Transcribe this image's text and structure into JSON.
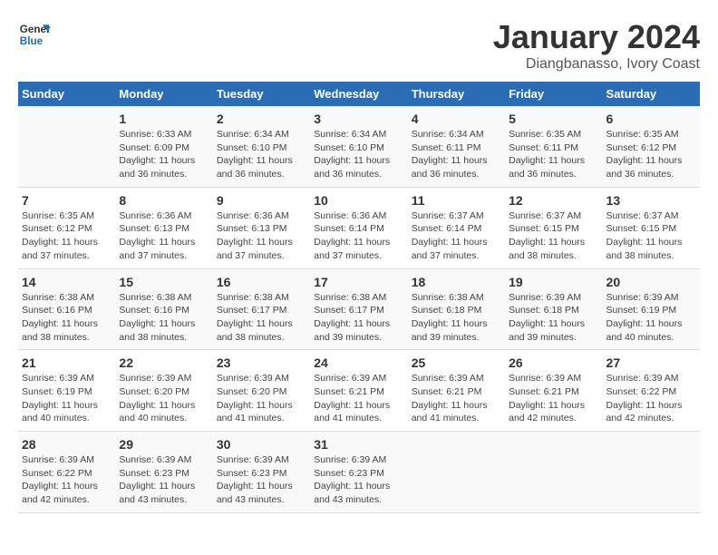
{
  "logo": {
    "line1": "General",
    "line2": "Blue"
  },
  "title": "January 2024",
  "subtitle": "Diangbanasso, Ivory Coast",
  "days_of_week": [
    "Sunday",
    "Monday",
    "Tuesday",
    "Wednesday",
    "Thursday",
    "Friday",
    "Saturday"
  ],
  "weeks": [
    [
      {
        "day": "",
        "info": ""
      },
      {
        "day": "1",
        "info": "Sunrise: 6:33 AM\nSunset: 6:09 PM\nDaylight: 11 hours\nand 36 minutes."
      },
      {
        "day": "2",
        "info": "Sunrise: 6:34 AM\nSunset: 6:10 PM\nDaylight: 11 hours\nand 36 minutes."
      },
      {
        "day": "3",
        "info": "Sunrise: 6:34 AM\nSunset: 6:10 PM\nDaylight: 11 hours\nand 36 minutes."
      },
      {
        "day": "4",
        "info": "Sunrise: 6:34 AM\nSunset: 6:11 PM\nDaylight: 11 hours\nand 36 minutes."
      },
      {
        "day": "5",
        "info": "Sunrise: 6:35 AM\nSunset: 6:11 PM\nDaylight: 11 hours\nand 36 minutes."
      },
      {
        "day": "6",
        "info": "Sunrise: 6:35 AM\nSunset: 6:12 PM\nDaylight: 11 hours\nand 36 minutes."
      }
    ],
    [
      {
        "day": "7",
        "info": "Sunrise: 6:35 AM\nSunset: 6:12 PM\nDaylight: 11 hours\nand 37 minutes."
      },
      {
        "day": "8",
        "info": "Sunrise: 6:36 AM\nSunset: 6:13 PM\nDaylight: 11 hours\nand 37 minutes."
      },
      {
        "day": "9",
        "info": "Sunrise: 6:36 AM\nSunset: 6:13 PM\nDaylight: 11 hours\nand 37 minutes."
      },
      {
        "day": "10",
        "info": "Sunrise: 6:36 AM\nSunset: 6:14 PM\nDaylight: 11 hours\nand 37 minutes."
      },
      {
        "day": "11",
        "info": "Sunrise: 6:37 AM\nSunset: 6:14 PM\nDaylight: 11 hours\nand 37 minutes."
      },
      {
        "day": "12",
        "info": "Sunrise: 6:37 AM\nSunset: 6:15 PM\nDaylight: 11 hours\nand 38 minutes."
      },
      {
        "day": "13",
        "info": "Sunrise: 6:37 AM\nSunset: 6:15 PM\nDaylight: 11 hours\nand 38 minutes."
      }
    ],
    [
      {
        "day": "14",
        "info": "Sunrise: 6:38 AM\nSunset: 6:16 PM\nDaylight: 11 hours\nand 38 minutes."
      },
      {
        "day": "15",
        "info": "Sunrise: 6:38 AM\nSunset: 6:16 PM\nDaylight: 11 hours\nand 38 minutes."
      },
      {
        "day": "16",
        "info": "Sunrise: 6:38 AM\nSunset: 6:17 PM\nDaylight: 11 hours\nand 38 minutes."
      },
      {
        "day": "17",
        "info": "Sunrise: 6:38 AM\nSunset: 6:17 PM\nDaylight: 11 hours\nand 39 minutes."
      },
      {
        "day": "18",
        "info": "Sunrise: 6:38 AM\nSunset: 6:18 PM\nDaylight: 11 hours\nand 39 minutes."
      },
      {
        "day": "19",
        "info": "Sunrise: 6:39 AM\nSunset: 6:18 PM\nDaylight: 11 hours\nand 39 minutes."
      },
      {
        "day": "20",
        "info": "Sunrise: 6:39 AM\nSunset: 6:19 PM\nDaylight: 11 hours\nand 40 minutes."
      }
    ],
    [
      {
        "day": "21",
        "info": "Sunrise: 6:39 AM\nSunset: 6:19 PM\nDaylight: 11 hours\nand 40 minutes."
      },
      {
        "day": "22",
        "info": "Sunrise: 6:39 AM\nSunset: 6:20 PM\nDaylight: 11 hours\nand 40 minutes."
      },
      {
        "day": "23",
        "info": "Sunrise: 6:39 AM\nSunset: 6:20 PM\nDaylight: 11 hours\nand 41 minutes."
      },
      {
        "day": "24",
        "info": "Sunrise: 6:39 AM\nSunset: 6:21 PM\nDaylight: 11 hours\nand 41 minutes."
      },
      {
        "day": "25",
        "info": "Sunrise: 6:39 AM\nSunset: 6:21 PM\nDaylight: 11 hours\nand 41 minutes."
      },
      {
        "day": "26",
        "info": "Sunrise: 6:39 AM\nSunset: 6:21 PM\nDaylight: 11 hours\nand 42 minutes."
      },
      {
        "day": "27",
        "info": "Sunrise: 6:39 AM\nSunset: 6:22 PM\nDaylight: 11 hours\nand 42 minutes."
      }
    ],
    [
      {
        "day": "28",
        "info": "Sunrise: 6:39 AM\nSunset: 6:22 PM\nDaylight: 11 hours\nand 42 minutes."
      },
      {
        "day": "29",
        "info": "Sunrise: 6:39 AM\nSunset: 6:23 PM\nDaylight: 11 hours\nand 43 minutes."
      },
      {
        "day": "30",
        "info": "Sunrise: 6:39 AM\nSunset: 6:23 PM\nDaylight: 11 hours\nand 43 minutes."
      },
      {
        "day": "31",
        "info": "Sunrise: 6:39 AM\nSunset: 6:23 PM\nDaylight: 11 hours\nand 43 minutes."
      },
      {
        "day": "",
        "info": ""
      },
      {
        "day": "",
        "info": ""
      },
      {
        "day": "",
        "info": ""
      }
    ]
  ]
}
